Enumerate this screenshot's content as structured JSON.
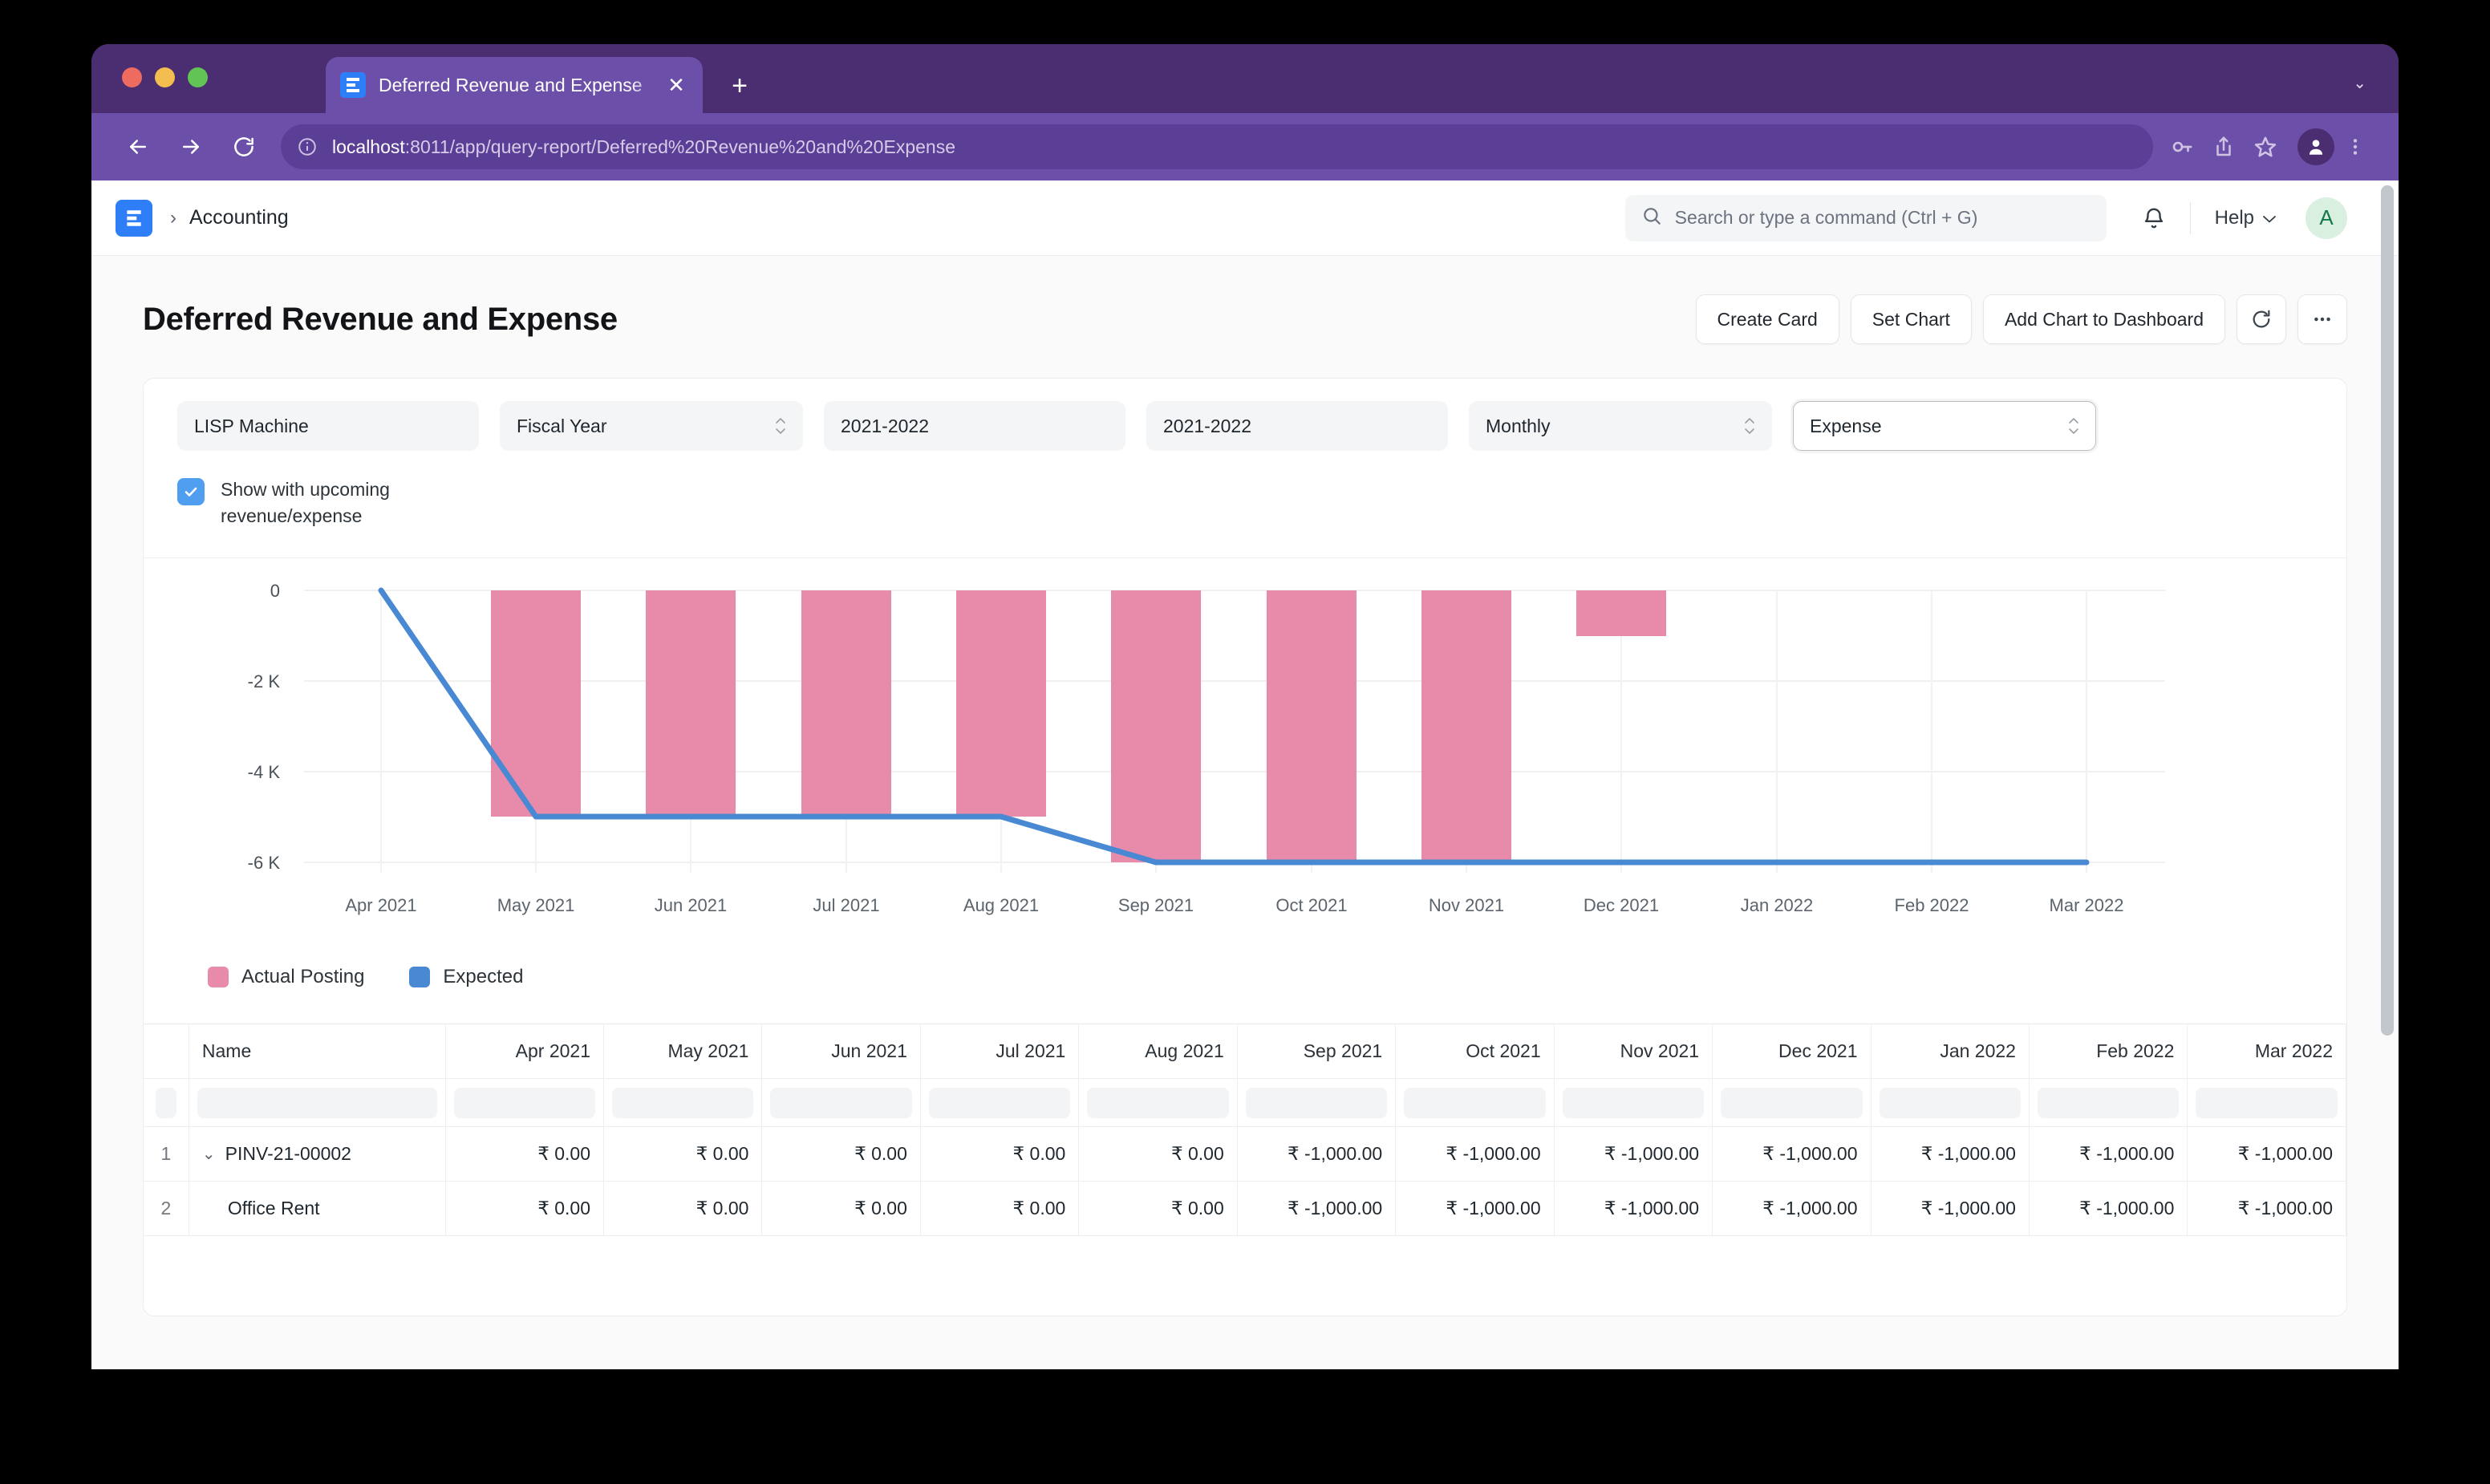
{
  "browser": {
    "tab": {
      "title": "Deferred Revenue and Expense",
      "close_label": "✕",
      "favicon_name": "erpnext-favicon"
    },
    "new_tab_label": "+",
    "tabstrip_chevron": "⌄",
    "omnibox": {
      "url_host": "localhost",
      "url_rest": ":8011/app/query-report/Deferred%20Revenue%20and%20Expense"
    },
    "toolbar_icons": [
      "back-icon",
      "forward-icon",
      "reload-icon",
      "password-key-icon",
      "share-icon",
      "bookmark-star-icon",
      "profile-avatar-icon",
      "browser-menu-icon"
    ]
  },
  "navbar": {
    "breadcrumb_separator": "›",
    "breadcrumb_item": "Accounting",
    "search_placeholder": "Search or type a command (Ctrl + G)",
    "help_label": "Help",
    "help_chevron": "⌄",
    "avatar_initial": "A"
  },
  "page": {
    "title": "Deferred Revenue and Expense",
    "actions": {
      "create_card": "Create Card",
      "set_chart": "Set Chart",
      "add_chart_to_dashboard": "Add Chart to Dashboard",
      "refresh": "⟳",
      "more": "⋯"
    }
  },
  "filters": {
    "company": "LISP Machine",
    "filter_based_on": "Fiscal Year",
    "from_fiscal_year": "2021-2022",
    "to_fiscal_year": "2021-2022",
    "periodicity": "Monthly",
    "type": "Expense",
    "checkbox_label": "Show with upcoming revenue/expense",
    "checkbox_checked": true
  },
  "chart_data": {
    "type": "bar",
    "title": "",
    "xlabel": "",
    "ylabel": "",
    "grid": true,
    "legend_position": "bottom-left",
    "categories": [
      "Apr 2021",
      "May 2021",
      "Jun 2021",
      "Jul 2021",
      "Aug 2021",
      "Sep 2021",
      "Oct 2021",
      "Nov 2021",
      "Dec 2021",
      "Jan 2022",
      "Feb 2022",
      "Mar 2022"
    ],
    "ylim": [
      -6000,
      0
    ],
    "yticks": [
      0,
      -2000,
      -4000,
      -6000
    ],
    "ytick_labels": [
      "0",
      "-2 K",
      "-4 K",
      "-6 K"
    ],
    "series": [
      {
        "name": "Actual Posting",
        "type": "bar",
        "color": "#e88aa9",
        "values": [
          0,
          -5000,
          -5000,
          -5000,
          -5000,
          -6000,
          -6000,
          -6000,
          -1000,
          0,
          0,
          0
        ]
      },
      {
        "name": "Expected",
        "type": "line",
        "color": "#4989d4",
        "values": [
          0,
          -5000,
          -5000,
          -5000,
          -5000,
          -6000,
          -6000,
          -6000,
          -6000,
          -6000,
          -6000,
          -6000
        ]
      }
    ]
  },
  "table": {
    "index_header": "",
    "columns": [
      "Name",
      "Apr 2021",
      "May 2021",
      "Jun 2021",
      "Jul 2021",
      "Aug 2021",
      "Sep 2021",
      "Oct 2021",
      "Nov 2021",
      "Dec 2021",
      "Jan 2022",
      "Feb 2022",
      "Mar 2022"
    ],
    "filter_placeholders": [
      "",
      "",
      "",
      "",
      "",
      "",
      "",
      "",
      "",
      "",
      "",
      "",
      ""
    ],
    "rows": [
      {
        "index": "1",
        "chevron": "⌄",
        "expandable": true,
        "name": "PINV-21-00002",
        "values": [
          "₹ 0.00",
          "₹ 0.00",
          "₹ 0.00",
          "₹ 0.00",
          "₹ 0.00",
          "₹ -1,000.00",
          "₹ -1,000.00",
          "₹ -1,000.00",
          "₹ -1,000.00",
          "₹ -1,000.00",
          "₹ -1,000.00",
          "₹ -1,000.00"
        ]
      },
      {
        "index": "2",
        "chevron": "",
        "expandable": false,
        "name": "Office Rent",
        "values": [
          "₹ 0.00",
          "₹ 0.00",
          "₹ 0.00",
          "₹ 0.00",
          "₹ 0.00",
          "₹ -1,000.00",
          "₹ -1,000.00",
          "₹ -1,000.00",
          "₹ -1,000.00",
          "₹ -1,000.00",
          "₹ -1,000.00",
          "₹ -1,000.00"
        ]
      }
    ]
  },
  "colors": {
    "browser_chrome": "#6c4fa8",
    "browser_tabstrip": "#4b2e72",
    "brand_blue": "#2e7ef7",
    "bar_pink": "#e88aa9",
    "line_blue": "#4989d4",
    "checkbox_blue": "#4f9ef0"
  }
}
